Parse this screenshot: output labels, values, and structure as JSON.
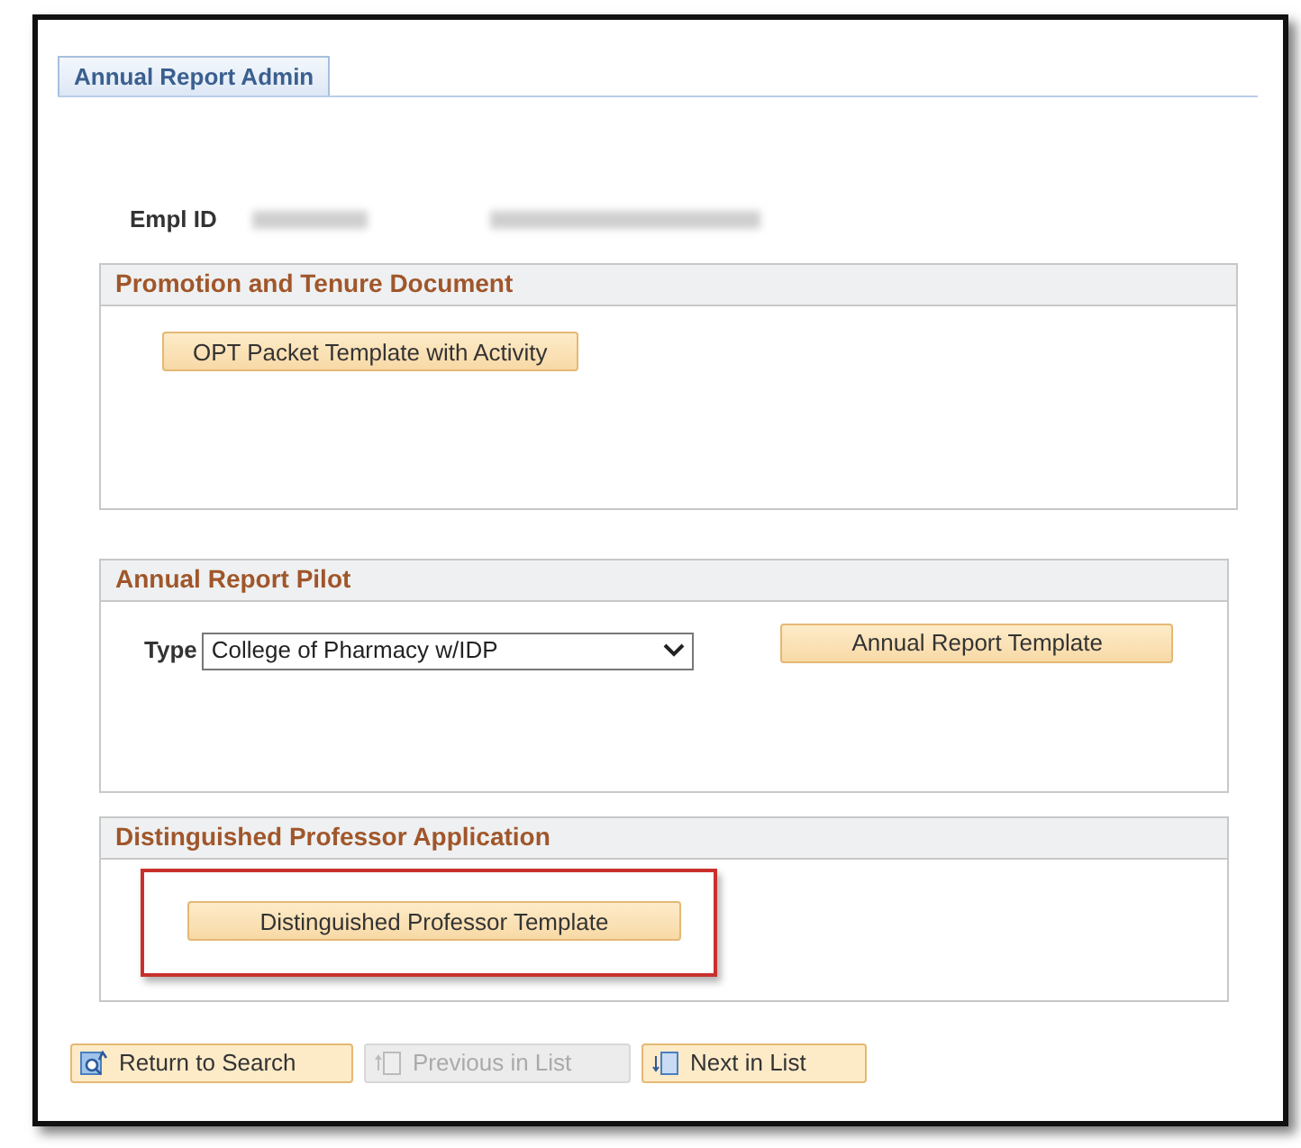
{
  "tab": {
    "label": "Annual Report Admin",
    "selected": true
  },
  "empl_id": {
    "label": "Empl ID"
  },
  "sections": [
    {
      "kind": "button",
      "title": "Promotion and Tenure Document",
      "button": {
        "label": "OPT Packet Template with Activity",
        "highlighted": false
      }
    },
    {
      "kind": "select",
      "title": "Annual Report Pilot",
      "field_label": "Type",
      "select_value": "College of Pharmacy w/IDP",
      "button": {
        "label": "Annual Report Template",
        "highlighted": false
      }
    },
    {
      "kind": "button",
      "title": "Distinguished Professor Application",
      "button": {
        "label": "Distinguished Professor Template",
        "highlighted": true
      }
    }
  ],
  "toolbar": [
    {
      "kind": "search",
      "label": "Return to Search",
      "disabled": false
    },
    {
      "kind": "previous",
      "label": "Previous in List",
      "disabled": true
    },
    {
      "kind": "next",
      "label": "Next in List",
      "disabled": false
    }
  ]
}
